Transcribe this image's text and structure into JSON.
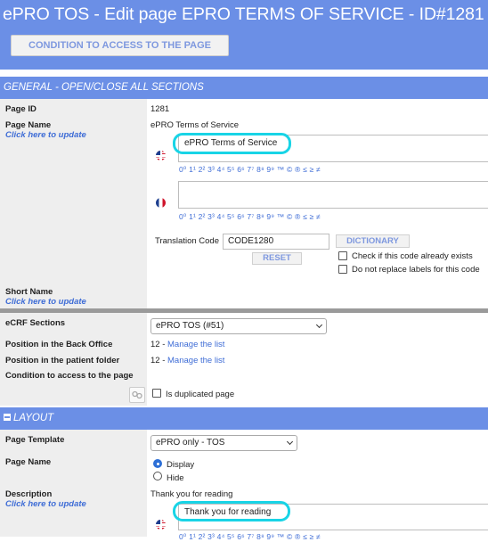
{
  "header": {
    "title": "ePRO TOS - Edit page EPRO TERMS OF SERVICE - ID#1281",
    "condition_button": "CONDITION TO ACCESS TO THE PAGE"
  },
  "general": {
    "section_title": "GENERAL - OPEN/CLOSE ALL SECTIONS",
    "page_id_label": "Page ID",
    "page_id_value": "1281",
    "page_name_label": "Page Name",
    "click_to_update": "Click here to update",
    "page_name_value": "ePRO Terms of Service",
    "english_value": "ePRO Terms of Service",
    "french_value": "",
    "special_chars": "0⁰ 1¹ 2² 3³ 4⁴ 5⁵ 6⁶ 7⁷ 8⁸ 9⁹ ™ © ® ≤ ≥ ≠",
    "translation_code_label": "Translation Code",
    "translation_code_value": "CODE1280",
    "dictionary_button": "DICTIONARY",
    "reset_button": "RESET",
    "check_exists_label": "Check if this code already exists",
    "no_replace_label": "Do not replace labels for this code",
    "short_name_label": "Short Name",
    "short_name_link": "Click here to update",
    "ecrf_label": "eCRF Sections",
    "ecrf_value": "ePRO TOS (#51)",
    "back_office_label": "Position in the Back Office",
    "back_office_value": "12 - ",
    "back_office_link": "Manage the list",
    "patient_folder_label": "Position in the patient folder",
    "patient_folder_value": "12 - ",
    "patient_folder_link": "Manage the list",
    "condition_label": "Condition to access to the page",
    "duplicated_label": "Is duplicated page"
  },
  "layout": {
    "section_title": "LAYOUT",
    "template_label": "Page Template",
    "template_value": "ePRO only - TOS",
    "page_name_label": "Page Name",
    "display_label": "Display",
    "hide_label": "Hide",
    "description_label": "Description",
    "description_link": "Click here to update",
    "description_value": "Thank you for reading",
    "english_value": "Thank you for reading"
  },
  "colors": {
    "header_blue": "#6b8fe6",
    "link_blue": "#3f6dd6",
    "highlight_cyan": "#18d4e6"
  }
}
